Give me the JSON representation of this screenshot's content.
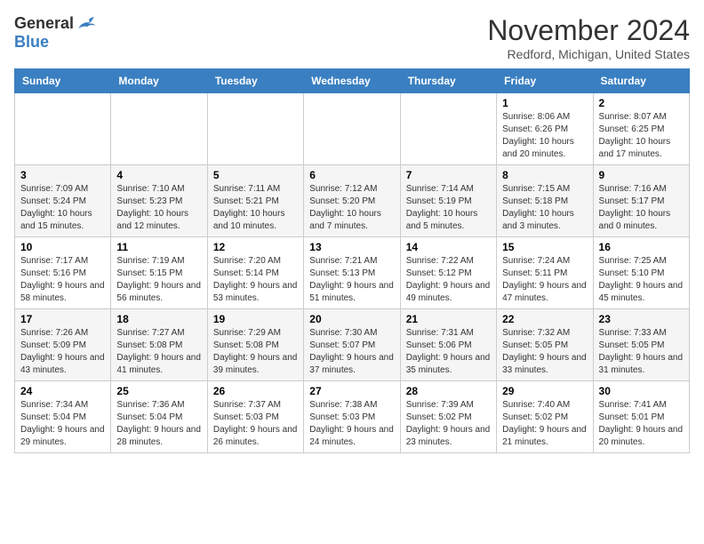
{
  "header": {
    "logo_general": "General",
    "logo_blue": "Blue",
    "month_title": "November 2024",
    "location": "Redford, Michigan, United States"
  },
  "weekdays": [
    "Sunday",
    "Monday",
    "Tuesday",
    "Wednesday",
    "Thursday",
    "Friday",
    "Saturday"
  ],
  "weeks": [
    [
      {
        "day": "",
        "info": ""
      },
      {
        "day": "",
        "info": ""
      },
      {
        "day": "",
        "info": ""
      },
      {
        "day": "",
        "info": ""
      },
      {
        "day": "",
        "info": ""
      },
      {
        "day": "1",
        "info": "Sunrise: 8:06 AM\nSunset: 6:26 PM\nDaylight: 10 hours and 20 minutes."
      },
      {
        "day": "2",
        "info": "Sunrise: 8:07 AM\nSunset: 6:25 PM\nDaylight: 10 hours and 17 minutes."
      }
    ],
    [
      {
        "day": "3",
        "info": "Sunrise: 7:09 AM\nSunset: 5:24 PM\nDaylight: 10 hours and 15 minutes."
      },
      {
        "day": "4",
        "info": "Sunrise: 7:10 AM\nSunset: 5:23 PM\nDaylight: 10 hours and 12 minutes."
      },
      {
        "day": "5",
        "info": "Sunrise: 7:11 AM\nSunset: 5:21 PM\nDaylight: 10 hours and 10 minutes."
      },
      {
        "day": "6",
        "info": "Sunrise: 7:12 AM\nSunset: 5:20 PM\nDaylight: 10 hours and 7 minutes."
      },
      {
        "day": "7",
        "info": "Sunrise: 7:14 AM\nSunset: 5:19 PM\nDaylight: 10 hours and 5 minutes."
      },
      {
        "day": "8",
        "info": "Sunrise: 7:15 AM\nSunset: 5:18 PM\nDaylight: 10 hours and 3 minutes."
      },
      {
        "day": "9",
        "info": "Sunrise: 7:16 AM\nSunset: 5:17 PM\nDaylight: 10 hours and 0 minutes."
      }
    ],
    [
      {
        "day": "10",
        "info": "Sunrise: 7:17 AM\nSunset: 5:16 PM\nDaylight: 9 hours and 58 minutes."
      },
      {
        "day": "11",
        "info": "Sunrise: 7:19 AM\nSunset: 5:15 PM\nDaylight: 9 hours and 56 minutes."
      },
      {
        "day": "12",
        "info": "Sunrise: 7:20 AM\nSunset: 5:14 PM\nDaylight: 9 hours and 53 minutes."
      },
      {
        "day": "13",
        "info": "Sunrise: 7:21 AM\nSunset: 5:13 PM\nDaylight: 9 hours and 51 minutes."
      },
      {
        "day": "14",
        "info": "Sunrise: 7:22 AM\nSunset: 5:12 PM\nDaylight: 9 hours and 49 minutes."
      },
      {
        "day": "15",
        "info": "Sunrise: 7:24 AM\nSunset: 5:11 PM\nDaylight: 9 hours and 47 minutes."
      },
      {
        "day": "16",
        "info": "Sunrise: 7:25 AM\nSunset: 5:10 PM\nDaylight: 9 hours and 45 minutes."
      }
    ],
    [
      {
        "day": "17",
        "info": "Sunrise: 7:26 AM\nSunset: 5:09 PM\nDaylight: 9 hours and 43 minutes."
      },
      {
        "day": "18",
        "info": "Sunrise: 7:27 AM\nSunset: 5:08 PM\nDaylight: 9 hours and 41 minutes."
      },
      {
        "day": "19",
        "info": "Sunrise: 7:29 AM\nSunset: 5:08 PM\nDaylight: 9 hours and 39 minutes."
      },
      {
        "day": "20",
        "info": "Sunrise: 7:30 AM\nSunset: 5:07 PM\nDaylight: 9 hours and 37 minutes."
      },
      {
        "day": "21",
        "info": "Sunrise: 7:31 AM\nSunset: 5:06 PM\nDaylight: 9 hours and 35 minutes."
      },
      {
        "day": "22",
        "info": "Sunrise: 7:32 AM\nSunset: 5:05 PM\nDaylight: 9 hours and 33 minutes."
      },
      {
        "day": "23",
        "info": "Sunrise: 7:33 AM\nSunset: 5:05 PM\nDaylight: 9 hours and 31 minutes."
      }
    ],
    [
      {
        "day": "24",
        "info": "Sunrise: 7:34 AM\nSunset: 5:04 PM\nDaylight: 9 hours and 29 minutes."
      },
      {
        "day": "25",
        "info": "Sunrise: 7:36 AM\nSunset: 5:04 PM\nDaylight: 9 hours and 28 minutes."
      },
      {
        "day": "26",
        "info": "Sunrise: 7:37 AM\nSunset: 5:03 PM\nDaylight: 9 hours and 26 minutes."
      },
      {
        "day": "27",
        "info": "Sunrise: 7:38 AM\nSunset: 5:03 PM\nDaylight: 9 hours and 24 minutes."
      },
      {
        "day": "28",
        "info": "Sunrise: 7:39 AM\nSunset: 5:02 PM\nDaylight: 9 hours and 23 minutes."
      },
      {
        "day": "29",
        "info": "Sunrise: 7:40 AM\nSunset: 5:02 PM\nDaylight: 9 hours and 21 minutes."
      },
      {
        "day": "30",
        "info": "Sunrise: 7:41 AM\nSunset: 5:01 PM\nDaylight: 9 hours and 20 minutes."
      }
    ]
  ]
}
